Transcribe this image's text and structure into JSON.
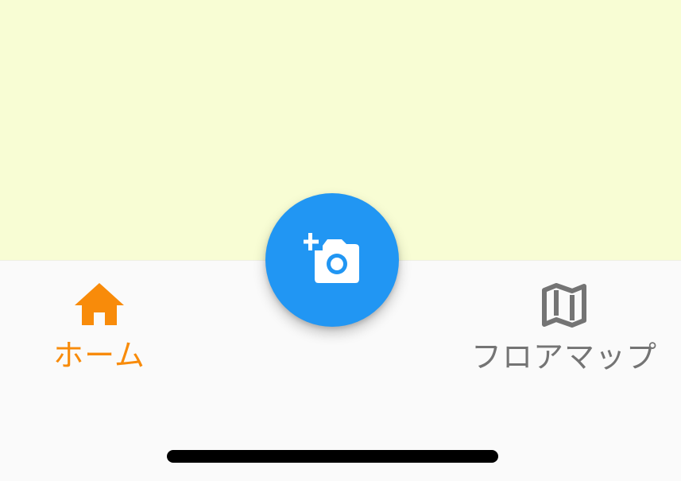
{
  "colors": {
    "content_background": "#f8fdd4",
    "bottom_bar_background": "#fafafa",
    "active_tab": "#f88b0a",
    "inactive_tab": "#747474",
    "fab_background": "#2196f3",
    "fab_icon": "#ffffff"
  },
  "bottom_nav": {
    "items": [
      {
        "label": "ホーム",
        "icon": "home-icon",
        "active": true
      },
      {
        "label": "フロアマップ",
        "icon": "map-icon",
        "active": false
      }
    ]
  },
  "fab": {
    "icon": "add-a-photo-icon"
  }
}
